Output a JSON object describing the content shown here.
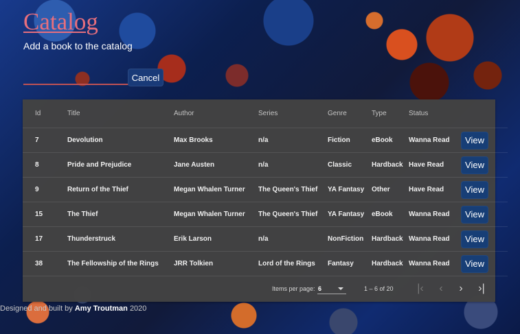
{
  "header": {
    "title": "Catalog",
    "subtitle": "Add a book to the catalog",
    "cancel_label": "Cancel"
  },
  "table": {
    "columns": [
      "Id",
      "Title",
      "Author",
      "Series",
      "Genre",
      "Type",
      "Status"
    ],
    "rows": [
      {
        "id": "7",
        "title": "Devolution",
        "author": "Max Brooks",
        "series": "n/a",
        "genre": "Fiction",
        "type": "eBook",
        "status": "Wanna Read",
        "view": "View"
      },
      {
        "id": "8",
        "title": "Pride and Prejudice",
        "author": "Jane Austen",
        "series": "n/a",
        "genre": "Classic",
        "type": "Hardback",
        "status": "Have Read",
        "view": "View"
      },
      {
        "id": "9",
        "title": "Return of the Thief",
        "author": "Megan Whalen Turner",
        "series": "The Queen's Thief",
        "genre": "YA Fantasy",
        "type": "Other",
        "status": "Have Read",
        "view": "View"
      },
      {
        "id": "15",
        "title": "The Thief",
        "author": "Megan Whalen Turner",
        "series": "The Queen's Thief",
        "genre": "YA Fantasy",
        "type": "eBook",
        "status": "Wanna Read",
        "view": "View"
      },
      {
        "id": "17",
        "title": "Thunderstruck",
        "author": "Erik Larson",
        "series": "n/a",
        "genre": "NonFiction",
        "type": "Hardback",
        "status": "Wanna Read",
        "view": "View"
      },
      {
        "id": "38",
        "title": "The Fellowship of the Rings",
        "author": "JRR Tolkien",
        "series": "Lord of the Rings",
        "genre": "Fantasy",
        "type": "Hardback",
        "status": "Wanna Read",
        "view": "View"
      }
    ]
  },
  "paginator": {
    "items_per_page_label": "Items per page:",
    "items_per_page_value": "6",
    "range_label": "1 – 6 of 20",
    "first_icon": "first-page-icon",
    "prev_icon": "chevron-left-icon",
    "next_icon": "chevron-right-icon",
    "last_icon": "last-page-icon"
  },
  "footer": {
    "prefix": "Designed and built by",
    "author": "Amy Troutman",
    "year": "2020"
  },
  "colors": {
    "accent": "#e86f7d",
    "button": "#173e76",
    "panel": "#424242"
  }
}
